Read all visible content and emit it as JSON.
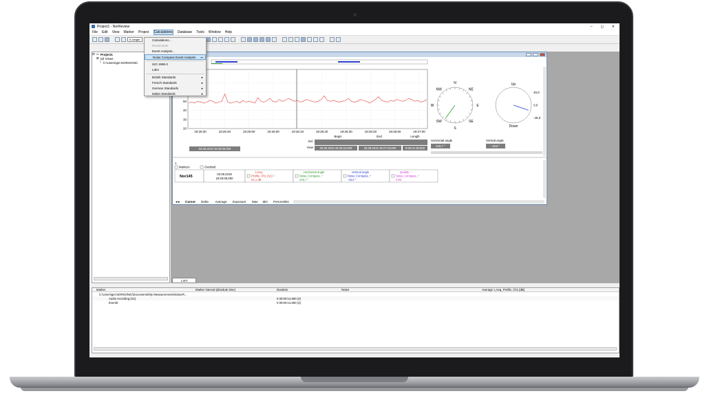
{
  "app": {
    "title": "Project1 - NorReview",
    "controls": [
      "–",
      "◻",
      "✕"
    ]
  },
  "menu": [
    "File",
    "Edit",
    "View",
    "Marker",
    "Project",
    "Calculations",
    "Database",
    "Tools",
    "Window",
    "Help"
  ],
  "toolbar": {
    "range_label": "K-ranger"
  },
  "calc_menu": {
    "items": [
      {
        "label": "Calculations...",
        "state": "normal"
      },
      {
        "label": "Recalculate",
        "state": "disabled"
      },
      {
        "label": "Event Analysis...",
        "state": "normal"
      },
      {
        "label": "Noise Compass Event Analysis",
        "state": "highlight"
      },
      {
        "label": "ISO 1996-2",
        "state": "normal"
      },
      {
        "label": "Lden",
        "state": "normal"
      },
      {
        "label": "British Standards",
        "state": "submenu"
      },
      {
        "label": "French Standards",
        "state": "submenu"
      },
      {
        "label": "German Standards",
        "state": "submenu"
      },
      {
        "label": "Italian Standards",
        "state": "submenu"
      }
    ]
  },
  "tree": {
    "project": "Project1",
    "views": "(d) Views",
    "path": "C:\\Users\\ger.NORSONIC"
  },
  "chart_data": {
    "type": "line",
    "x_ticks": [
      "19:25:30",
      "19:25:40",
      "19:25:50",
      "19:26:00",
      "19:26:10",
      "19:26:20",
      "19:26:30",
      "19:26:40",
      "19:26:50",
      "19:27:00"
    ],
    "y_ticks": [
      "20",
      "30",
      "40",
      "50",
      "60",
      "70"
    ],
    "ylim": [
      20,
      85
    ],
    "series_color": "#e8453c",
    "series": [
      {
        "values": [
          48,
          49,
          48,
          50,
          49,
          48,
          49,
          51,
          50,
          48,
          49,
          50,
          58,
          49,
          48,
          49,
          50,
          48,
          51,
          49,
          50,
          49,
          48,
          54,
          50,
          49,
          51,
          53,
          50,
          49,
          52,
          50,
          51,
          53,
          52,
          50,
          51,
          49,
          50,
          52,
          51,
          50,
          49,
          50,
          52,
          56,
          51,
          50,
          51,
          50,
          49,
          50,
          51,
          53,
          50,
          49,
          50,
          52,
          51,
          50,
          48,
          50,
          52,
          55,
          51,
          50,
          49,
          51,
          50,
          52,
          51,
          50,
          51,
          53,
          52,
          50,
          51,
          49,
          50,
          52
        ]
      }
    ]
  },
  "info": {
    "begin_label": "Begin",
    "end_label": "End",
    "length_label": "Length",
    "sel_label": "Sel.",
    "view_label": "View",
    "cursor_time": "03.09.2019 19:26:09,000",
    "view_begin": "03.09.2019 19:25:24,000",
    "view_end": "03.09.2019 19:27:03,000",
    "view_length": "0:00:01:39,000",
    "h_angle_label": "Horizontal angle",
    "h_angle": "215,7 °",
    "v_angle_label": "Vertical angle",
    "v_angle": "-18,6 °"
  },
  "compass": {
    "labels": [
      "N",
      "NE",
      "E",
      "SE",
      "S",
      "SW",
      "W",
      "NW"
    ]
  },
  "vertical_dial": {
    "up": "Up",
    "down": "Down",
    "p45": "45,0",
    "zero": "0,0",
    "m45": "-45,0"
  },
  "legend": {
    "row_index": "1",
    "markers_label": "Markers",
    "overlaid_label": "Overlaid",
    "device": "Nor145",
    "device_time1": "03.09.2019",
    "device_time2": "19:26:09,000",
    "cells": [
      {
        "title": "LAeq,",
        "line1": "Profile, Ch1 (S1) ÷",
        "line2": "51,1 dB",
        "color": "#d83a32"
      },
      {
        "title": "Horizontal angle",
        "line1": "Noise Compass, ÷",
        "line2": "215,7 °",
        "color": "#2d9a2d"
      },
      {
        "title": "Vertical angle",
        "line1": "Noise Compass, ÷",
        "line2": "-18,6 °",
        "color": "#2b3fd1"
      },
      {
        "title": "Quality",
        "line1": "Noise Compass, ÷",
        "line2": "0,83",
        "color": "#d43ad4"
      }
    ]
  },
  "bottom_tabs": [
    "Cursor",
    "Delta",
    "Average",
    "Exposure",
    "Max",
    "Min",
    "Percentiles"
  ],
  "doc_tab": "LIST",
  "marker_table": {
    "headers": [
      "Marker",
      "Marker interval (absolute time)",
      "Duration",
      "Notes",
      "Average: LAeq, Profile, Ch1 [dB]"
    ],
    "rows": [
      [
        "C:\\Users\\ger.NORSONIC\\Documents\\My Measurements\\indoorR...",
        "",
        "",
        "",
        ""
      ],
      [
        "Audio recording (S1)",
        "",
        "0 00:00:14,600 (2)",
        "",
        ""
      ],
      [
        "Event0",
        "",
        "0 00:00:14,600 (2)",
        "",
        ""
      ]
    ]
  }
}
